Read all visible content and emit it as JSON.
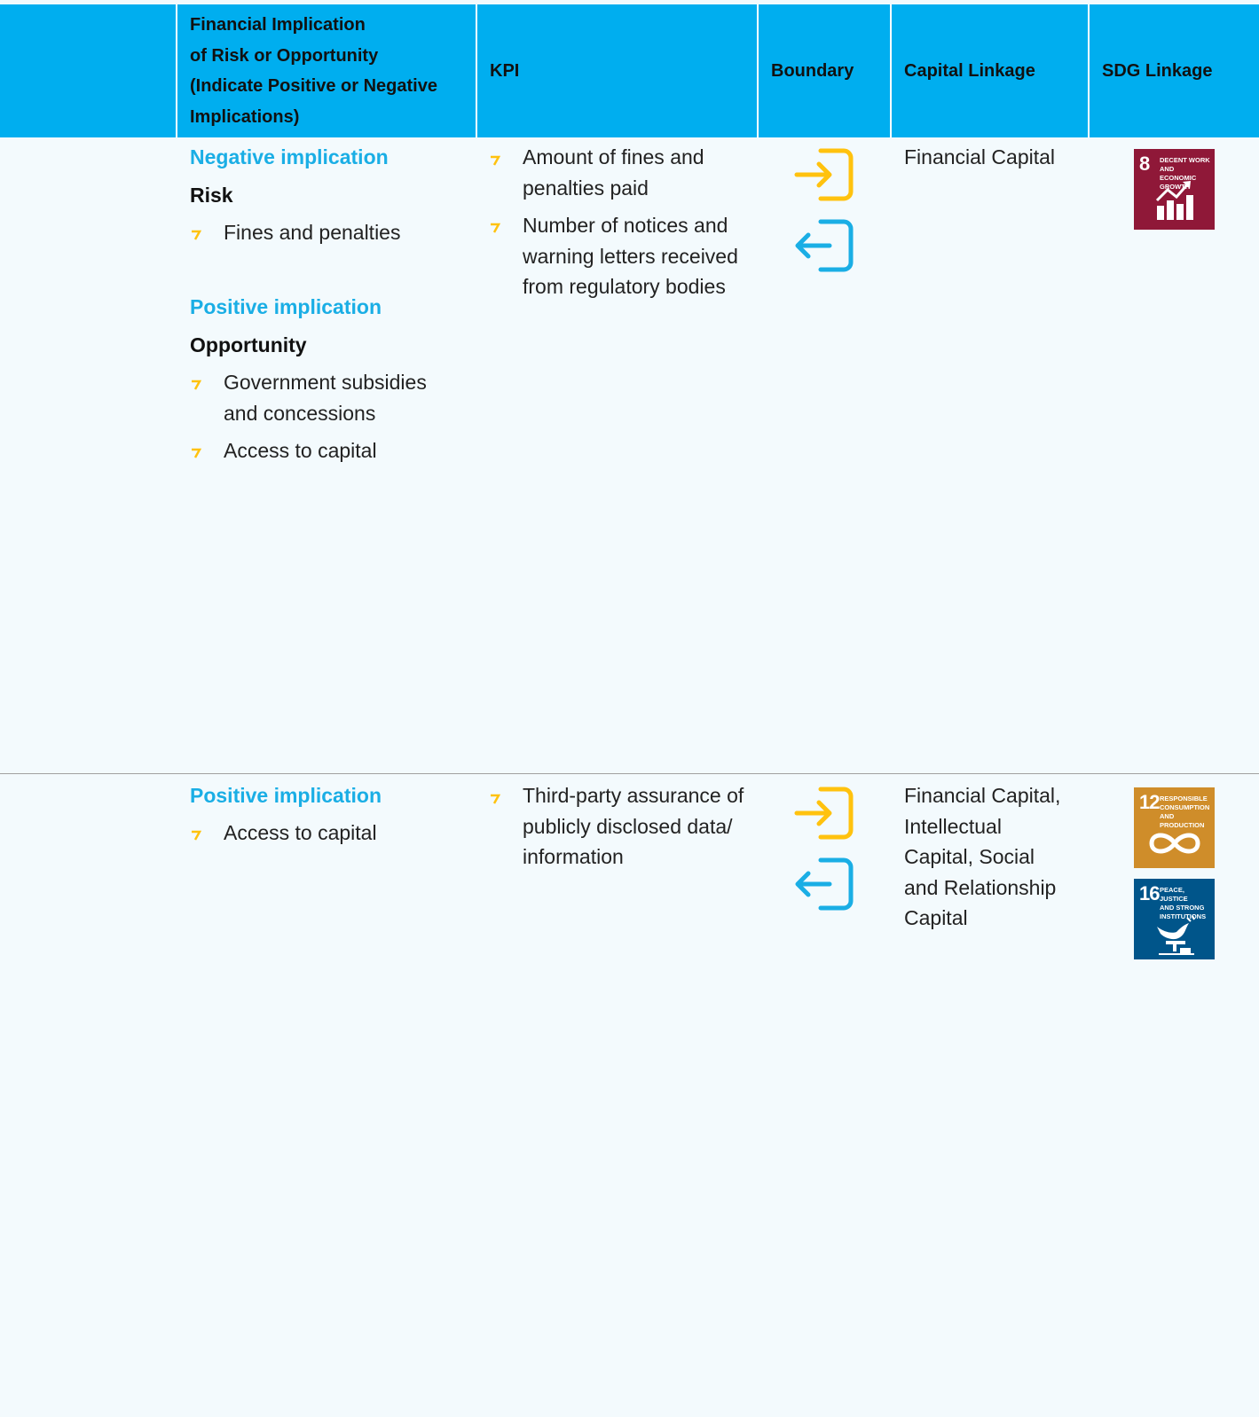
{
  "header": {
    "col_financial": [
      "Financial Implication",
      "of Risk or Opportunity",
      "(Indicate Positive or Negative",
      "Implications)"
    ],
    "col_kpi": "KPI",
    "col_boundary": "Boundary",
    "col_capital": "Capital Linkage",
    "col_sdg": "SDG Linkage"
  },
  "rows": [
    {
      "negative_heading": "Negative implication",
      "risk_heading": "Risk",
      "risk_items": [
        "Fines and penalties"
      ],
      "positive_heading": "Positive implication",
      "opportunity_heading": "Opportunity",
      "opportunity_items": [
        [
          "Government subsidies",
          "and concessions"
        ],
        [
          "Access to capital"
        ]
      ],
      "kpis": [
        [
          "Amount of fines and",
          "penalties paid"
        ],
        [
          "Number of notices and",
          "warning letters received",
          "from regulatory bodies"
        ]
      ],
      "boundary_icons": [
        "boundary-in-icon",
        "boundary-out-icon"
      ],
      "capital_linkage": [
        "Financial Capital"
      ],
      "sdgs": [
        {
          "number": "8",
          "label": [
            "DECENT WORK AND",
            "ECONOMIC GROWTH"
          ],
          "color": "#8f1838",
          "icon": "growth-chart-icon"
        }
      ]
    },
    {
      "positive_heading": "Positive implication",
      "opportunity_items": [
        [
          "Access to capital"
        ]
      ],
      "kpis": [
        [
          "Third-party assurance of",
          "publicly disclosed data/",
          "information"
        ]
      ],
      "boundary_icons": [
        "boundary-in-icon",
        "boundary-out-icon"
      ],
      "capital_linkage": [
        "Financial Capital,",
        "Intellectual",
        "Capital, Social",
        "and Relationship",
        "Capital"
      ],
      "sdgs": [
        {
          "number": "12",
          "label": [
            "RESPONSIBLE",
            "CONSUMPTION",
            "AND PRODUCTION"
          ],
          "color": "#cf8d2a",
          "icon": "infinity-icon"
        },
        {
          "number": "16",
          "label": [
            "PEACE, JUSTICE",
            "AND STRONG",
            "INSTITUTIONS"
          ],
          "color": "#00558a",
          "icon": "dove-gavel-icon"
        }
      ]
    }
  ],
  "colors": {
    "header_bg": "#00aeef",
    "body_bg": "#f3fafd",
    "heading_blue": "#1aaee5",
    "bullet_yellow": "#ffc20e",
    "icon_in_yellow": "#ffc20e",
    "icon_out_blue": "#1aaee5"
  }
}
